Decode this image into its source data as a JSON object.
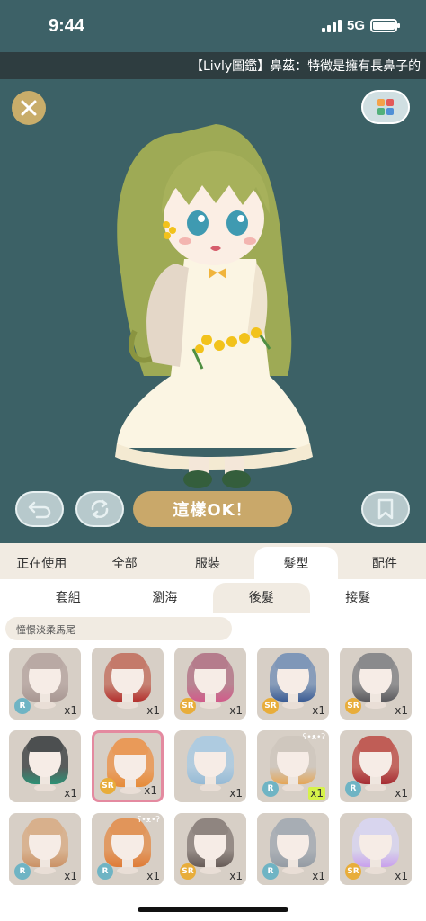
{
  "status": {
    "time": "9:44",
    "network": "5G"
  },
  "ticker": {
    "text": "【Livly圖鑑】鼻茲：特徵是擁有長鼻子的"
  },
  "stage": {
    "ok_label": "這樣OK！"
  },
  "tabs": [
    {
      "label": "正在使用",
      "active": false
    },
    {
      "label": "全部",
      "active": false
    },
    {
      "label": "服裝",
      "active": false
    },
    {
      "label": "髮型",
      "active": true
    },
    {
      "label": "配件",
      "active": false
    }
  ],
  "subtabs": [
    {
      "label": "套組",
      "active": false
    },
    {
      "label": "瀏海",
      "active": false
    },
    {
      "label": "後髮",
      "active": true
    },
    {
      "label": "接髮",
      "active": false
    }
  ],
  "filter": {
    "label": "憧憬淡柔馬尾"
  },
  "items": [
    {
      "rarity": "R",
      "qty": "x1",
      "color": "#b9a9a4",
      "accent": "#a3918d"
    },
    {
      "rarity": "",
      "qty": "x1",
      "color": "#c47a6a",
      "accent": "#b0201e"
    },
    {
      "rarity": "SR",
      "qty": "x1",
      "color": "#b57c8c",
      "accent": "#d04f84"
    },
    {
      "rarity": "SR",
      "qty": "x1",
      "color": "#7f97b8",
      "accent": "#2a4f8e"
    },
    {
      "rarity": "SR",
      "qty": "x1",
      "color": "#8a8a8c",
      "accent": "#4d4d52"
    },
    {
      "rarity": "",
      "qty": "x1",
      "color": "#4c4f50",
      "accent": "#1a8a6c"
    },
    {
      "rarity": "SR",
      "qty": "x1",
      "color": "#e99a59",
      "accent": "#e88429",
      "selected": true
    },
    {
      "rarity": "",
      "qty": "x1",
      "color": "#aecbe0",
      "accent": "#8fb8d7"
    },
    {
      "rarity": "R",
      "qty": "x1",
      "color": "#cfc7be",
      "accent": "#e6a24c",
      "bear": true,
      "highlight": true
    },
    {
      "rarity": "R",
      "qty": "x1",
      "color": "#c05d56",
      "accent": "#a01a22"
    },
    {
      "rarity": "R",
      "qty": "x1",
      "color": "#d8b08c",
      "accent": "#c98b5b"
    },
    {
      "rarity": "R",
      "qty": "x1",
      "color": "#e1955a",
      "accent": "#e07226",
      "bear": true
    },
    {
      "rarity": "SR",
      "qty": "x1",
      "color": "#8f8580",
      "accent": "#5a4f4b"
    },
    {
      "rarity": "R",
      "qty": "x1",
      "color": "#a7adb4",
      "accent": "#8d96a0"
    },
    {
      "rarity": "SR",
      "qty": "x1",
      "color": "#d8d5ee",
      "accent": "#c79bf0"
    }
  ]
}
